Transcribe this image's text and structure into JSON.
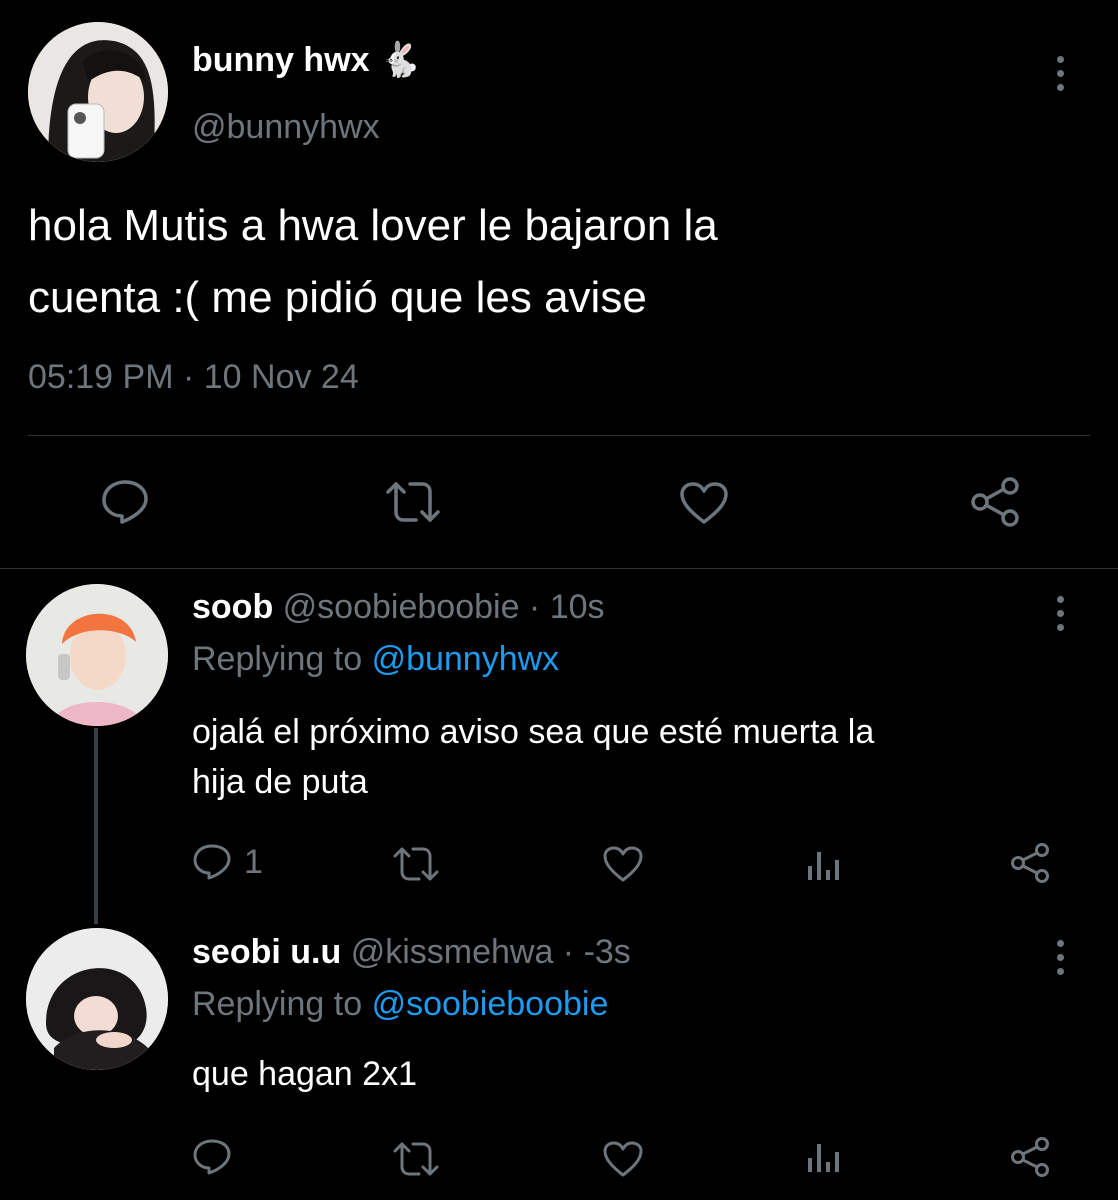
{
  "main_tweet": {
    "display_name": "bunny hwx",
    "name_emoji": "🐇",
    "handle": "@bunnyhwx",
    "text_line1": "hola Mutis a hwa lover le bajaron la",
    "text_line2": "cuenta :( me pidió que les avise",
    "timestamp": "05:19 PM · 10 Nov 24"
  },
  "replies": [
    {
      "display_name": "soob",
      "handle_time": "@soobieboobie · 10s",
      "replying_label": "Replying to",
      "replying_to": "@bunnyhwx",
      "text_line1": "ojalá el próximo aviso sea que esté muerta la",
      "text_line2": "hija de puta",
      "reply_count": "1"
    },
    {
      "display_name": "seobi u.u",
      "handle_time": "@kissmehwa · -3s",
      "replying_label": "Replying to",
      "replying_to": "@soobieboobie",
      "text_line1": "que hagan 2x1",
      "reply_count": ""
    }
  ],
  "colors": {
    "background": "#000000",
    "muted": "#6e767d",
    "link": "#1d9bf0",
    "divider": "#2f3336"
  },
  "icons": [
    "comment-icon",
    "retweet-icon",
    "heart-icon",
    "share-icon",
    "analytics-icon",
    "more-icon"
  ]
}
